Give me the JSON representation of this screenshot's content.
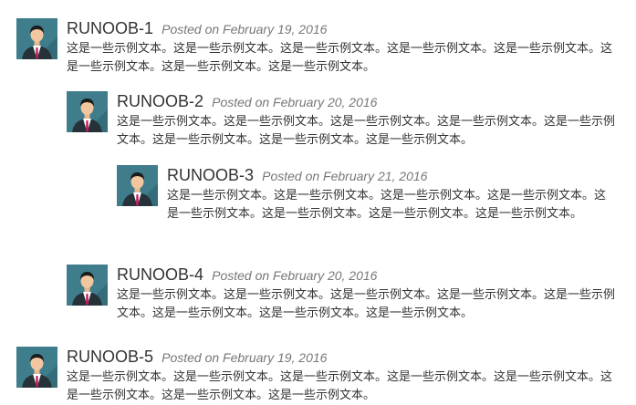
{
  "comments": [
    {
      "name": "RUNOOB-1",
      "posted": "Posted on February 19, 2016",
      "text": "这是一些示例文本。这是一些示例文本。这是一些示例文本。这是一些示例文本。这是一些示例文本。这是一些示例文本。这是一些示例文本。这是一些示例文本。",
      "avatar_icon": "user-avatar-icon"
    },
    {
      "name": "RUNOOB-2",
      "posted": "Posted on February 20, 2016",
      "text": "这是一些示例文本。这是一些示例文本。这是一些示例文本。这是一些示例文本。这是一些示例文本。这是一些示例文本。这是一些示例文本。这是一些示例文本。",
      "avatar_icon": "user-avatar-icon"
    },
    {
      "name": "RUNOOB-3",
      "posted": "Posted on February 21, 2016",
      "text": "这是一些示例文本。这是一些示例文本。这是一些示例文本。这是一些示例文本。这是一些示例文本。这是一些示例文本。这是一些示例文本。这是一些示例文本。",
      "avatar_icon": "user-avatar-icon"
    },
    {
      "name": "RUNOOB-4",
      "posted": "Posted on February 20, 2016",
      "text": "这是一些示例文本。这是一些示例文本。这是一些示例文本。这是一些示例文本。这是一些示例文本。这是一些示例文本。这是一些示例文本。这是一些示例文本。",
      "avatar_icon": "user-avatar-icon"
    },
    {
      "name": "RUNOOB-5",
      "posted": "Posted on February 19, 2016",
      "text": "这是一些示例文本。这是一些示例文本。这是一些示例文本。这是一些示例文本。这是一些示例文本。这是一些示例文本。这是一些示例文本。这是一些示例文本。",
      "avatar_icon": "user-avatar-icon"
    }
  ],
  "colors": {
    "avatar_bg": "#3f7d8c",
    "name": "#333333",
    "posted": "#777777",
    "text": "#333333"
  }
}
